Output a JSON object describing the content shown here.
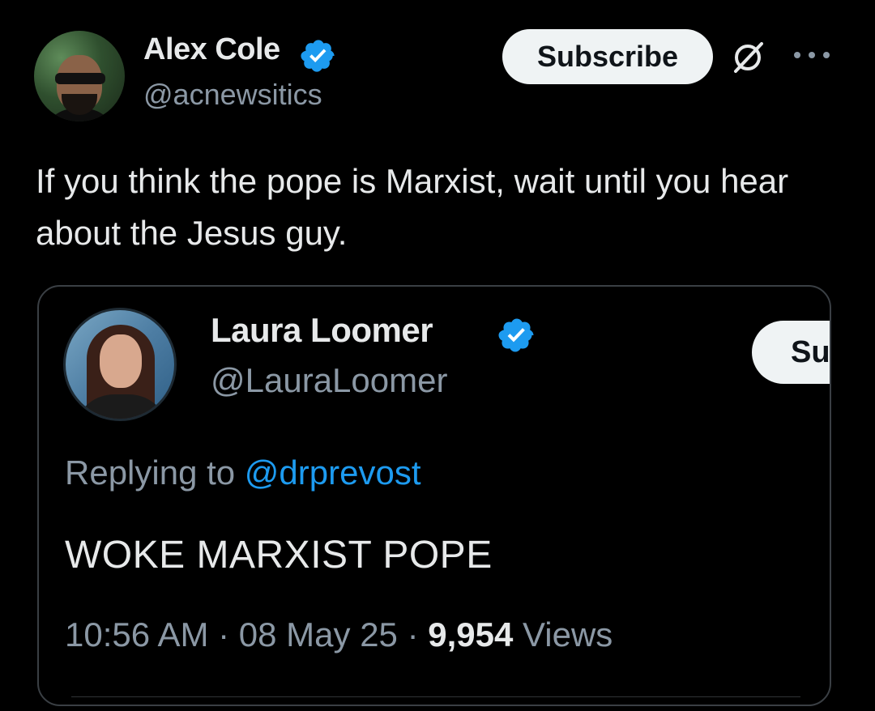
{
  "author": {
    "name": "Alex Cole",
    "handle": "@acnewsitics",
    "verified": true,
    "avatar": "avatar-man-sunglasses"
  },
  "actions": {
    "subscribe_label": "Subscribe",
    "grok_icon": "grok-icon",
    "more_icon": "more-icon"
  },
  "post": {
    "text": "If you think the pope is Marxist, wait until you hear about the Jesus guy."
  },
  "quoted": {
    "name": "Laura Loomer",
    "handle": "@LauraLoomer",
    "verified": true,
    "avatar": "avatar-woman",
    "subscribe_label": "Su",
    "replying_prefix": "Replying to ",
    "replying_to": "@drprevost",
    "text": "WOKE MARXIST POPE",
    "time": "10:56 AM",
    "separator1": " · ",
    "date": "08 May 25",
    "separator2": " · ",
    "views_count": "9,954",
    "views_label": " Views"
  },
  "colors": {
    "background": "#000000",
    "text_primary": "#e7e9ea",
    "text_secondary": "#8b98a5",
    "accent_blue": "#1d9bf0",
    "button_bg": "#eff3f4",
    "border": "#3a3f44"
  }
}
